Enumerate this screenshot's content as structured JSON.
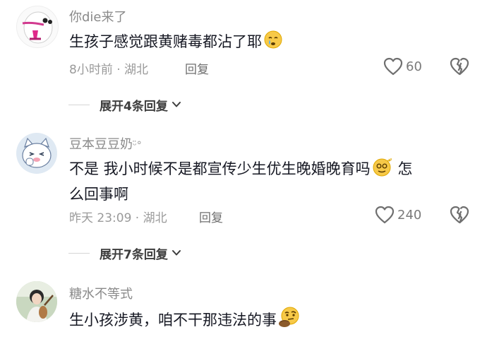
{
  "comments": [
    {
      "username": "你die来了",
      "text": "生孩子感觉跟黄赌毒都沾了耶",
      "emoji": "crying-face-emoji",
      "meta": "8小时前 · 湖北",
      "reply_label": "回复",
      "likes": "60",
      "expand_label": "展开4条回复"
    },
    {
      "username": "豆本豆豆奶",
      "username_badge": "ᵕ̈°",
      "text_line1": "不是 我小时候不是都宣传少生优生晚婚晚育吗",
      "text_line1_tail": " 怎",
      "text_line2": "么回事啊",
      "emoji": "dizzy-face-emoji",
      "meta": "昨天 23:09 · 湖北",
      "reply_label": "回复",
      "likes": "240",
      "expand_label": "展开7条回复"
    },
    {
      "username": "糖水不等式",
      "text": "生小孩涉黄，咱不干那违法的事",
      "emoji": "thinking-face-emoji"
    }
  ],
  "colors": {
    "text": "#161823",
    "username": "#8a8a8a",
    "meta": "#9a9a9a",
    "accent_emoji": "#f5c518"
  }
}
